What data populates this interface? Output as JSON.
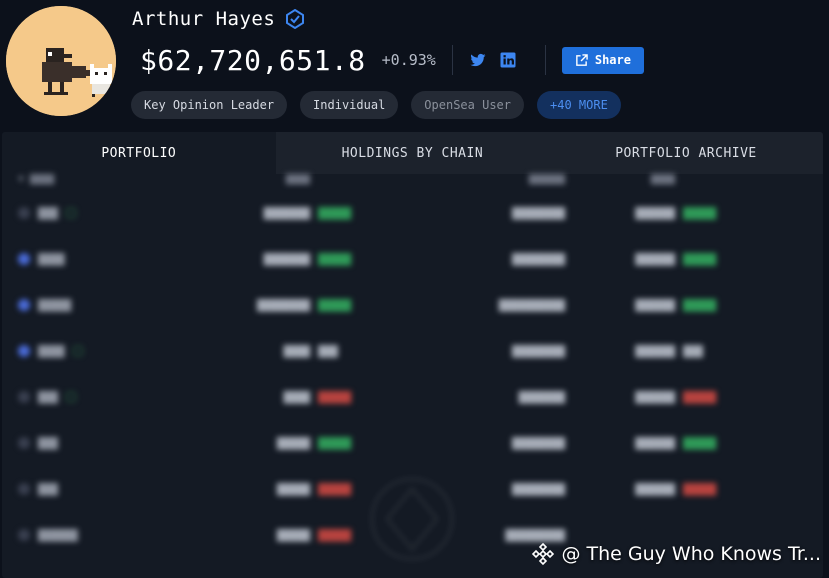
{
  "profile": {
    "name": "Arthur Hayes",
    "balance": "$62,720,651.8",
    "change": "+0.93%",
    "share_label": "Share",
    "tags": [
      "Key Opinion Leader",
      "Individual",
      "OpenSea User",
      "+40 MORE"
    ]
  },
  "icons": {
    "verified": "verified-badge-icon",
    "twitter": "twitter-icon",
    "linkedin": "linkedin-icon",
    "share": "external-link-icon"
  },
  "colors": {
    "accent": "#1f6fdb",
    "background": "#0c111b",
    "panel": "#141a24",
    "positive": "#2f9a58",
    "negative": "#b8433f"
  },
  "tabs": [
    "PORTFOLIO",
    "HOLDINGS BY CHAIN",
    "PORTFOLIO ARCHIVE"
  ],
  "watermark": {
    "text": "@ The Guy Who Knows Tr..."
  }
}
